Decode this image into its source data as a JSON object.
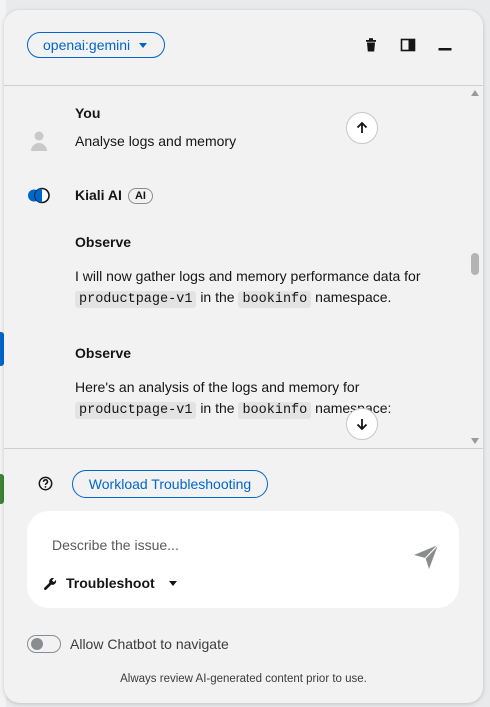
{
  "header": {
    "model_selector": "openai:gemini",
    "icons": [
      "trash-icon",
      "sidebar-layout-icon",
      "minimize-icon"
    ]
  },
  "messages": {
    "user": {
      "author": "You",
      "text": "Analyse logs and memory"
    },
    "bot": {
      "author": "Kiali AI",
      "badge": "AI",
      "blocks": [
        {
          "heading": "Observe",
          "line1": "I will now gather logs and memory performance data for",
          "code1": "productpage-v1",
          "mid": "in the",
          "code2": "bookinfo",
          "tail": "namespace."
        },
        {
          "heading": "Observe",
          "line1": "Here's an analysis of the logs and memory for",
          "code1": "productpage-v1",
          "mid": "in the",
          "code2": "bookinfo",
          "tail": "namespace:"
        }
      ]
    }
  },
  "footer": {
    "suggested_prompt": "Workload Troubleshooting",
    "input_placeholder": "Describe the issue...",
    "mode": "Troubleshoot",
    "toggle_label": "Allow Chatbot to navigate",
    "toggle_on": false,
    "disclaimer": "Always review AI-generated content prior to use."
  },
  "colors": {
    "accent": "#0066cc",
    "panel": "#f2f2f2",
    "input": "#ffffff"
  }
}
